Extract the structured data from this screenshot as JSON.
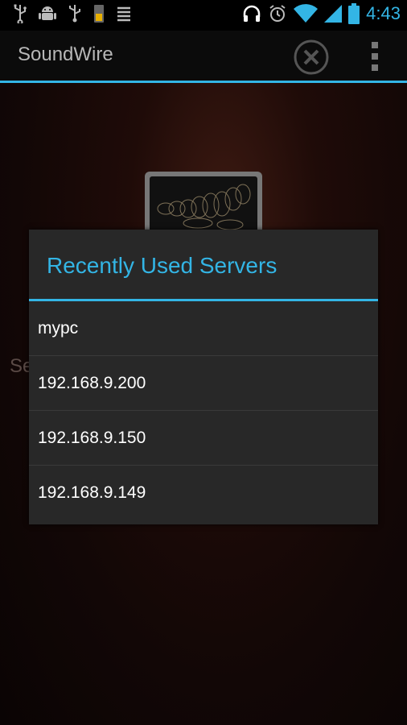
{
  "status_bar": {
    "time": "4:43",
    "icons_left": [
      "usb-icon",
      "android-debug-icon",
      "usb-icon",
      "sd-card-icon",
      "list-icon"
    ],
    "icons_right": [
      "headphones-icon",
      "alarm-icon",
      "wifi-icon",
      "signal-icon",
      "battery-icon"
    ]
  },
  "action_bar": {
    "title": "SoundWire",
    "close_icon": "close-circle-icon",
    "overflow_icon": "overflow-menu-icon"
  },
  "background": {
    "partial_label": "Se"
  },
  "dialog": {
    "title": "Recently Used Servers",
    "servers": [
      "mypc",
      "192.168.9.200",
      "192.168.9.150",
      "192.168.9.149"
    ]
  },
  "colors": {
    "accent": "#33b5e5",
    "dialog_bg": "#282828",
    "actionbar_bg": "#0b0b0b"
  }
}
